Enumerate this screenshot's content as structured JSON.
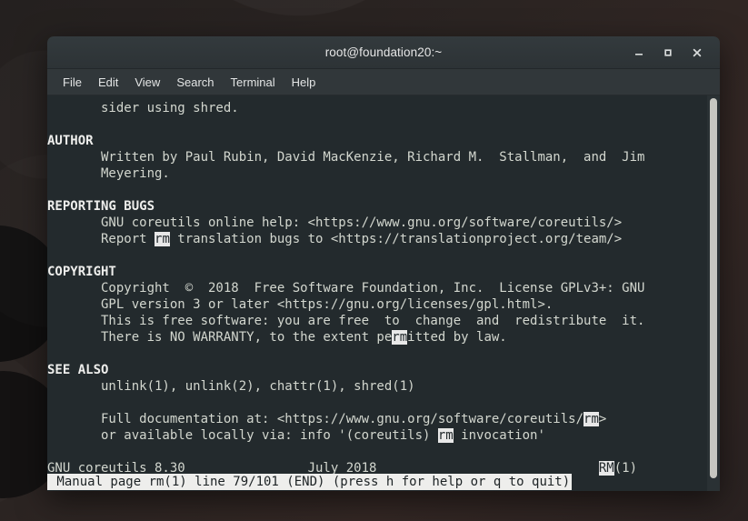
{
  "window": {
    "title": "root@foundation20:~",
    "controls": [
      {
        "name": "minimize-button",
        "glyph": "—"
      },
      {
        "name": "maximize-button",
        "glyph": "□"
      },
      {
        "name": "close-button",
        "glyph": "✕"
      }
    ]
  },
  "menubar": {
    "items": [
      {
        "label": "File"
      },
      {
        "label": "Edit"
      },
      {
        "label": "View"
      },
      {
        "label": "Search"
      },
      {
        "label": "Terminal"
      },
      {
        "label": "Help"
      }
    ]
  },
  "terminal": {
    "program": "man",
    "page": "rm(1)",
    "colors": {
      "background": "#232a2d",
      "foreground": "#d3d7cf",
      "highlight_background": "#e8e8e8",
      "highlight_foreground": "#232a2d",
      "titlebar": "#2e3436",
      "desktop": "#2e2422"
    },
    "lines": [
      {
        "segments": [
          {
            "text": "       sider using shred."
          }
        ]
      },
      {
        "segments": [
          {
            "text": ""
          }
        ]
      },
      {
        "segments": [
          {
            "text": "AUTHOR",
            "style": "bold"
          }
        ]
      },
      {
        "segments": [
          {
            "text": "       Written by Paul Rubin, David MacKenzie, Richard M.  Stallman,  and  Jim"
          }
        ]
      },
      {
        "segments": [
          {
            "text": "       Meyering."
          }
        ]
      },
      {
        "segments": [
          {
            "text": ""
          }
        ]
      },
      {
        "segments": [
          {
            "text": "REPORTING BUGS",
            "style": "bold"
          }
        ]
      },
      {
        "segments": [
          {
            "text": "       GNU coreutils online help: <https://www.gnu.org/software/coreutils/>"
          }
        ]
      },
      {
        "segments": [
          {
            "text": "       Report "
          },
          {
            "text": "rm",
            "style": "highlight"
          },
          {
            "text": " translation bugs to <https://translationproject.org/team/>"
          }
        ]
      },
      {
        "segments": [
          {
            "text": ""
          }
        ]
      },
      {
        "segments": [
          {
            "text": "COPYRIGHT",
            "style": "bold"
          }
        ]
      },
      {
        "segments": [
          {
            "text": "       Copyright  ©  2018  Free Software Foundation, Inc.  License GPLv3+: GNU"
          }
        ]
      },
      {
        "segments": [
          {
            "text": "       GPL version 3 or later <https://gnu.org/licenses/gpl.html>."
          }
        ]
      },
      {
        "segments": [
          {
            "text": "       This is free software: you are free  to  change  and  redistribute  it."
          }
        ]
      },
      {
        "segments": [
          {
            "text": "       There is NO WARRANTY, to the extent pe"
          },
          {
            "text": "rm",
            "style": "highlight"
          },
          {
            "text": "itted by law."
          }
        ]
      },
      {
        "segments": [
          {
            "text": ""
          }
        ]
      },
      {
        "segments": [
          {
            "text": "SEE ALSO",
            "style": "bold"
          }
        ]
      },
      {
        "segments": [
          {
            "text": "       unlink(1), unlink(2), chattr(1), shred(1)"
          }
        ]
      },
      {
        "segments": [
          {
            "text": ""
          }
        ]
      },
      {
        "segments": [
          {
            "text": "       Full documentation at: <https://www.gnu.org/software/coreutils/"
          },
          {
            "text": "rm",
            "style": "highlight"
          },
          {
            "text": ">"
          }
        ]
      },
      {
        "segments": [
          {
            "text": "       or available locally via: info '(coreutils) "
          },
          {
            "text": "rm",
            "style": "highlight"
          },
          {
            "text": " invocation'"
          }
        ]
      },
      {
        "segments": [
          {
            "text": ""
          }
        ]
      },
      {
        "segments": [
          {
            "text": "GNU coreutils 8.30                July 2018                             "
          },
          {
            "text": "RM",
            "style": "highlight"
          },
          {
            "text": "(1)"
          }
        ]
      }
    ],
    "status_bar": {
      "text": " Manual page rm(1) line 79/101 (END) (press h for help or q to quit)",
      "page_name": "rm(1)",
      "line_current": "79",
      "line_total": "101",
      "position": "(END)",
      "hint": "(press h for help or q to quit)"
    },
    "scrollbar": {
      "thumb_percent": "96"
    }
  }
}
